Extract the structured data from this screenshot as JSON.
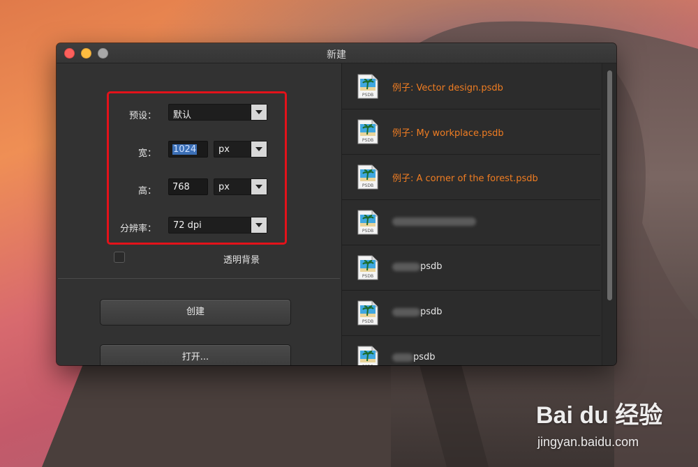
{
  "window": {
    "title": "新建"
  },
  "form": {
    "preset": {
      "label": "预设：",
      "value": "默认"
    },
    "width": {
      "label": "宽：",
      "value": "1024",
      "unit": "px"
    },
    "height": {
      "label": "高：",
      "value": "768",
      "unit": "px"
    },
    "resolution": {
      "label": "分辨率：",
      "value": "72 dpi"
    },
    "transparent_background": {
      "label": "透明背景",
      "checked": false
    }
  },
  "buttons": {
    "create": "创建",
    "open": "打开..."
  },
  "recent_files": [
    {
      "name": "例子: Vector design.psdb",
      "icon_text": "PSDB",
      "style": "example"
    },
    {
      "name": "例子: My workplace.psdb",
      "icon_text": "PSDB",
      "style": "example"
    },
    {
      "name": "例子: A corner of the forest.psdb",
      "icon_text": "PSDB",
      "style": "example"
    },
    {
      "name": "",
      "icon_text": "PSDB",
      "style": "redacted"
    },
    {
      "name": "psdb",
      "icon_text": "PSDB",
      "style": "redacted"
    },
    {
      "name": "psdb",
      "icon_text": "PSDB",
      "style": "redacted"
    },
    {
      "name": "psdb",
      "icon_text": "PSDB",
      "style": "redacted"
    }
  ],
  "watermark": {
    "logo_text": "Bai du 经验",
    "url": "jingyan.baidu.com"
  },
  "colors": {
    "accent_orange": "#f07d22",
    "highlight_red": "#e3121a",
    "selection_blue": "#3b6fb6"
  }
}
